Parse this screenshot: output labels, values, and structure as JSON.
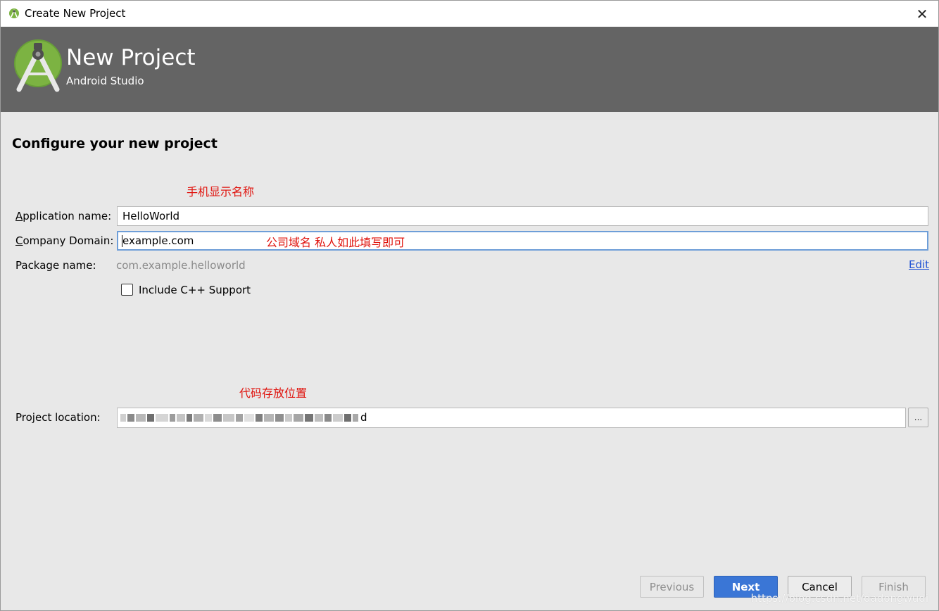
{
  "window": {
    "title": "Create New Project",
    "close_glyph": "✕"
  },
  "banner": {
    "title": "New Project",
    "subtitle": "Android Studio",
    "logo_icon": "android-studio-icon"
  },
  "page": {
    "heading": "Configure your new project"
  },
  "annotations": {
    "app_name_note": "手机显示名称",
    "domain_note": "公司域名  私人如此填写即可",
    "location_note": "代码存放位置"
  },
  "form": {
    "app_name": {
      "label_mnemonic": "A",
      "label_rest": "pplication name:",
      "value": "HelloWorld"
    },
    "company_domain": {
      "label_mnemonic": "C",
      "label_rest": "ompany Domain:",
      "value": "example.com"
    },
    "package_name": {
      "label": "Package name:",
      "value": "com.example.helloworld",
      "edit_label": "Edit"
    },
    "cpp_support": {
      "label": "Include C++ Support",
      "checked": false
    },
    "project_location": {
      "label": "Project location:",
      "value_tail": "d",
      "browse_label": "..."
    }
  },
  "footer": {
    "previous_label": "Previous",
    "next_label": "Next",
    "cancel_label": "Cancel",
    "finish_label": "Finish"
  },
  "watermark": "https://blog.csdn.net/dadongwudi",
  "colors": {
    "banner": "#646464",
    "annotation": "#e0140e",
    "link": "#2153d4",
    "primary_button": "#3a76d6"
  }
}
